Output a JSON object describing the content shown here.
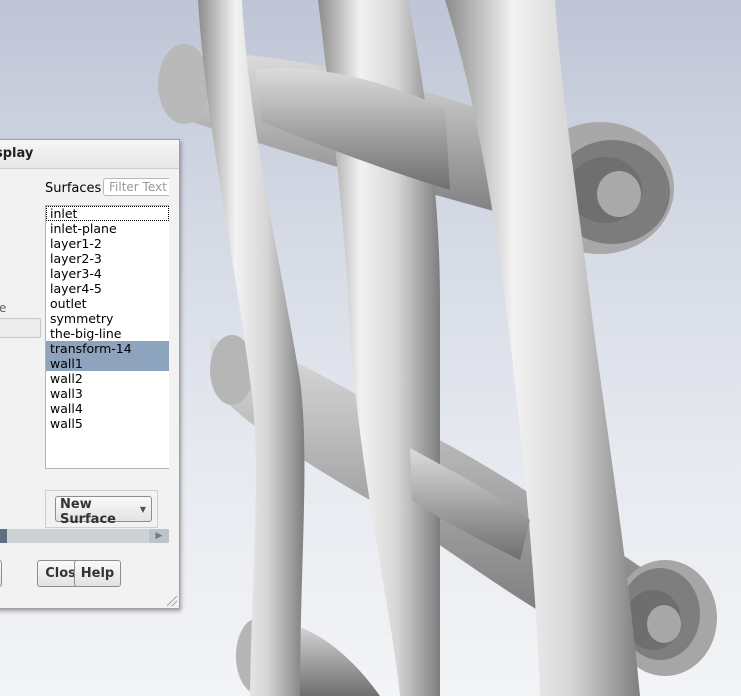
{
  "dialog": {
    "title_partial": "splay",
    "surfaces_label": "Surfaces",
    "filter_placeholder": "Filter Text",
    "left_fragment": "e",
    "new_surface_label": "New Surface",
    "close_label": "Close",
    "help_label": "Help"
  },
  "surfaces": [
    {
      "label": "inlet",
      "selected": false,
      "focused": true
    },
    {
      "label": "inlet-plane",
      "selected": false
    },
    {
      "label": "layer1-2",
      "selected": false
    },
    {
      "label": "layer2-3",
      "selected": false
    },
    {
      "label": "layer3-4",
      "selected": false
    },
    {
      "label": "layer4-5",
      "selected": false
    },
    {
      "label": "outlet",
      "selected": false
    },
    {
      "label": "symmetry",
      "selected": false
    },
    {
      "label": "the-big-line",
      "selected": false
    },
    {
      "label": "transform-14",
      "selected": true
    },
    {
      "label": "wall1",
      "selected": true
    },
    {
      "label": "wall2",
      "selected": false
    },
    {
      "label": "wall3",
      "selected": false
    },
    {
      "label": "wall4",
      "selected": false
    },
    {
      "label": "wall5",
      "selected": false
    }
  ],
  "colors": {
    "selection": "#8ea3bd",
    "background_top": "#bfc5d6",
    "background_bottom": "#f3f4f6",
    "geometry": "#b4b4b4"
  },
  "icons": {
    "dropdown": "chevron-down-icon",
    "scroll_right": "arrow-right-icon",
    "resize": "resize-grip-icon"
  }
}
